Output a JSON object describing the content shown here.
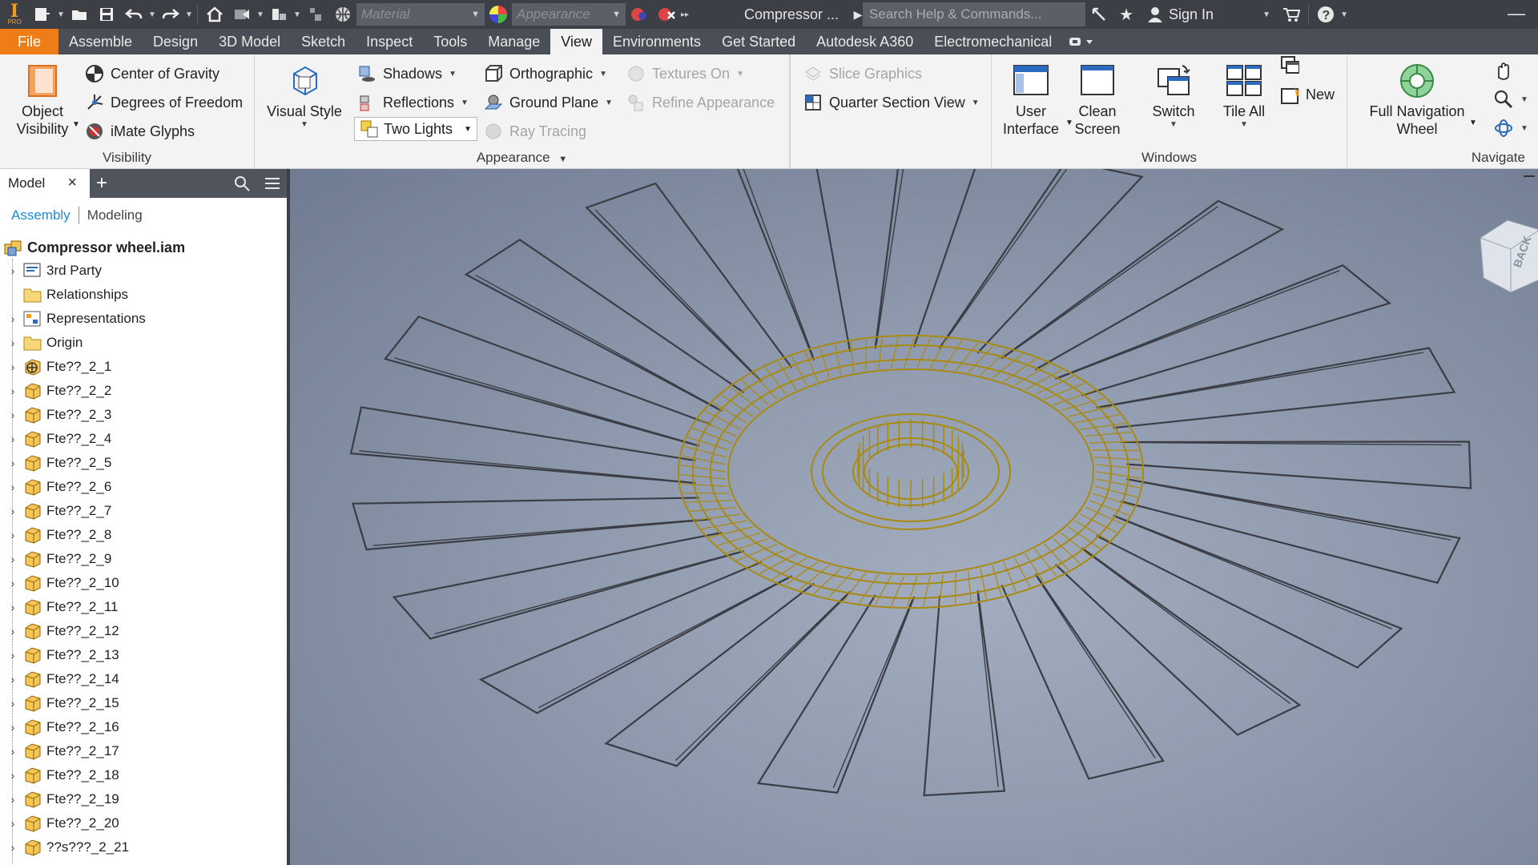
{
  "app": {
    "doc_title": "Compressor ...",
    "material_placeholder": "Material",
    "appearance_placeholder": "Appearance",
    "search_placeholder": "Search Help & Commands...",
    "sign_in": "Sign In",
    "logo_letter": "I",
    "logo_sub": "PRO"
  },
  "tabs": [
    "File",
    "Assemble",
    "Design",
    "3D Model",
    "Sketch",
    "Inspect",
    "Tools",
    "Manage",
    "View",
    "Environments",
    "Get Started",
    "Autodesk A360",
    "Electromechanical"
  ],
  "active_tab": "View",
  "ribbon": {
    "visibility": {
      "title": "Visibility",
      "object_visibility": "Object\nVisibility",
      "center_of_gravity": "Center of Gravity",
      "degrees_of_freedom": "Degrees of Freedom",
      "imate_glyphs": "iMate Glyphs"
    },
    "appearance": {
      "title": "Appearance",
      "visual_style": "Visual Style",
      "shadows": "Shadows",
      "reflections": "Reflections",
      "two_lights": "Two Lights",
      "orthographic": "Orthographic",
      "ground_plane": "Ground Plane",
      "ray_tracing": "Ray Tracing",
      "textures_on": "Textures On",
      "refine_appearance": "Refine Appearance",
      "slice_graphics": "Slice Graphics",
      "quarter_section_view": "Quarter Section View"
    },
    "windows": {
      "title": "Windows",
      "user_interface": "User\nInterface",
      "clean_screen": "Clean\nScreen",
      "switch": "Switch",
      "tile_all": "Tile All",
      "new": "New"
    },
    "navigate": {
      "title": "Navigate",
      "full_navigation_wheel": "Full Navigation\nWheel"
    }
  },
  "browser": {
    "tab_label": "Model",
    "sub_assembly": "Assembly",
    "sub_modeling": "Modeling",
    "root": "Compressor wheel.iam",
    "items": [
      {
        "label": "3rd Party",
        "icon": "third-party-icon"
      },
      {
        "label": "Relationships",
        "icon": "folder-icon"
      },
      {
        "label": "Representations",
        "icon": "representations-icon"
      },
      {
        "label": "Origin",
        "icon": "folder-icon"
      },
      {
        "label": "Fte??_2_1",
        "icon": "part-grounded-icon"
      },
      {
        "label": "Fte??_2_2",
        "icon": "part-icon"
      },
      {
        "label": "Fte??_2_3",
        "icon": "part-icon"
      },
      {
        "label": "Fte??_2_4",
        "icon": "part-icon"
      },
      {
        "label": "Fte??_2_5",
        "icon": "part-icon"
      },
      {
        "label": "Fte??_2_6",
        "icon": "part-icon"
      },
      {
        "label": "Fte??_2_7",
        "icon": "part-icon"
      },
      {
        "label": "Fte??_2_8",
        "icon": "part-icon"
      },
      {
        "label": "Fte??_2_9",
        "icon": "part-icon"
      },
      {
        "label": "Fte??_2_10",
        "icon": "part-icon"
      },
      {
        "label": "Fte??_2_11",
        "icon": "part-icon"
      },
      {
        "label": "Fte??_2_12",
        "icon": "part-icon"
      },
      {
        "label": "Fte??_2_13",
        "icon": "part-icon"
      },
      {
        "label": "Fte??_2_14",
        "icon": "part-icon"
      },
      {
        "label": "Fte??_2_15",
        "icon": "part-icon"
      },
      {
        "label": "Fte??_2_16",
        "icon": "part-icon"
      },
      {
        "label": "Fte??_2_17",
        "icon": "part-icon"
      },
      {
        "label": "Fte??_2_18",
        "icon": "part-icon"
      },
      {
        "label": "Fte??_2_19",
        "icon": "part-icon"
      },
      {
        "label": "Fte??_2_20",
        "icon": "part-icon"
      },
      {
        "label": "??s???_2_21",
        "icon": "part-icon"
      }
    ]
  },
  "viewcube": {
    "face_label": "BACK"
  },
  "colors": {
    "accent_file_tab": "#ef7d17",
    "link_blue": "#1a8be0",
    "wire_gold": "#a88a10",
    "wire_dark": "#3a3d44"
  }
}
